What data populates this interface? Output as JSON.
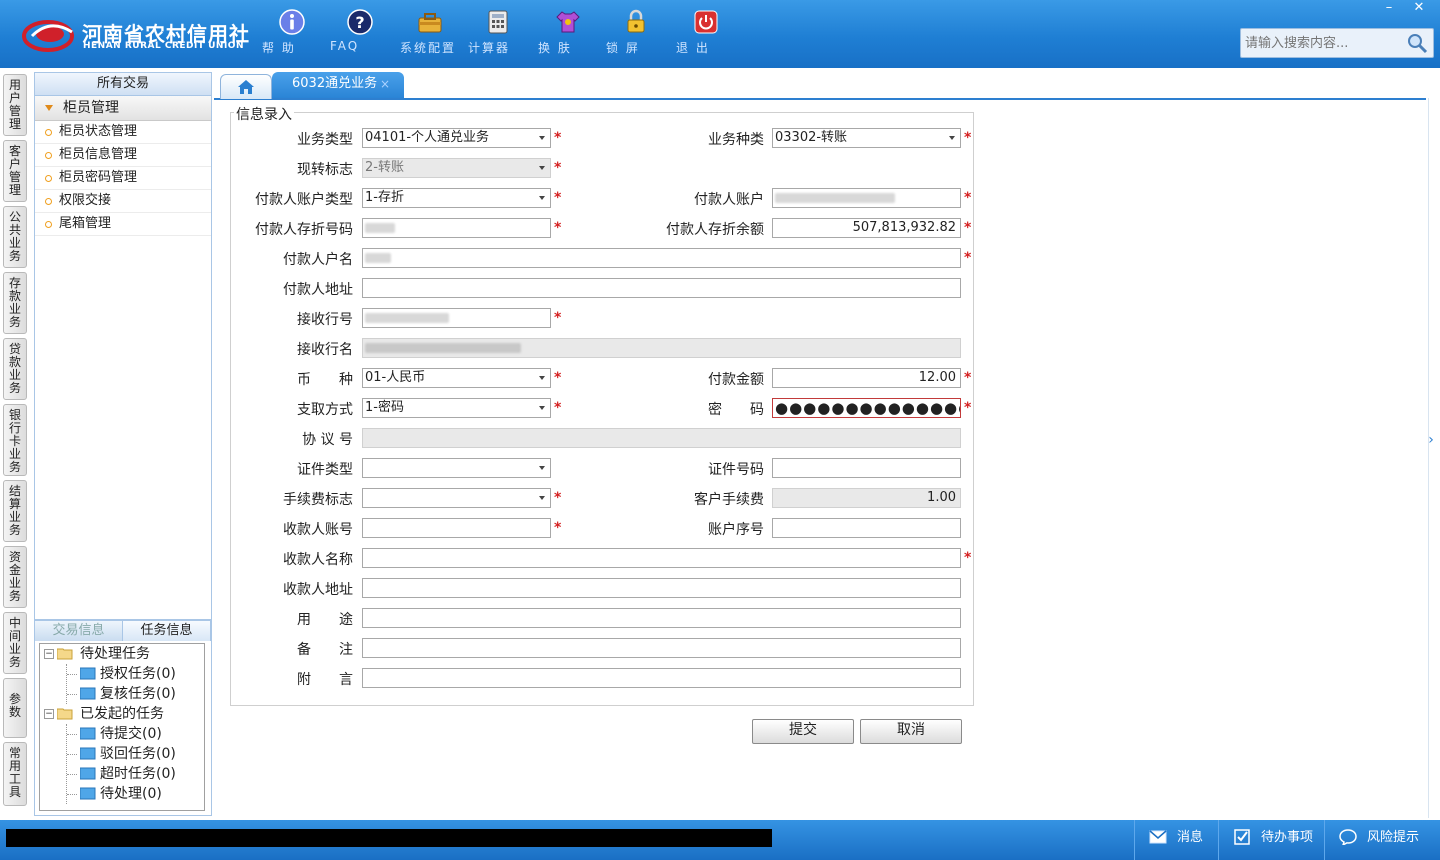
{
  "app": {
    "logo_cn": "河南省农村信用社",
    "logo_en": "HENAN RURAL CREDIT UNION",
    "toolbar": [
      {
        "label": "帮 助",
        "icon": "info-icon"
      },
      {
        "label": "FAQ",
        "icon": "question-icon"
      },
      {
        "label": "系统配置",
        "icon": "toolbox-icon"
      },
      {
        "label": "计算器",
        "icon": "calculator-icon"
      },
      {
        "label": "换 肤",
        "icon": "tshirt-icon"
      },
      {
        "label": "锁 屏",
        "icon": "lock-icon"
      },
      {
        "label": "退 出",
        "icon": "power-icon"
      }
    ],
    "window": {
      "minimize": "–",
      "close": "✕"
    },
    "search": {
      "placeholder": "请输入搜索内容..."
    }
  },
  "vtabs": [
    "用户管理",
    "客户管理",
    "公共业务",
    "存款业务",
    "贷款业务",
    "银行卡业务",
    "结算业务",
    "资金业务",
    "中间业务",
    "参数",
    "常用工具"
  ],
  "sidebar": {
    "title": "所有交易",
    "group": "柜员管理",
    "items": [
      "柜员状态管理",
      "柜员信息管理",
      "柜员密码管理",
      "权限交接",
      "尾箱管理"
    ]
  },
  "taskpanel": {
    "tabs": [
      "交易信息",
      "任务信息"
    ],
    "tree": {
      "pending": "待处理任务",
      "auth": "授权任务(0)",
      "review": "复核任务(0)",
      "initiated": "已发起的任务",
      "to_submit": "待提交(0)",
      "rejected": "驳回任务(0)",
      "timeout": "超时任务(0)",
      "to_process": "待处理(0)"
    }
  },
  "content": {
    "active_tab": "6032通兑业务",
    "tab_close": "×",
    "fieldset": "信息录入",
    "labels": {
      "biz_type": "业务类型",
      "biz_kind": "业务种类",
      "cash_flag": "现转标志",
      "payer_acct_type": "付款人账户类型",
      "payer_acct": "付款人账户",
      "passbook_no": "付款人存折号码",
      "passbook_bal": "付款人存折余额",
      "payer_name": "付款人户名",
      "payer_addr": "付款人地址",
      "recv_bank_no": "接收行号",
      "recv_bank_name": "接收行名",
      "currency": "币　　种",
      "amount": "付款金额",
      "withdraw_method": "支取方式",
      "password": "密　　码",
      "agreement_no": "协 议 号",
      "id_type": "证件类型",
      "id_no": "证件号码",
      "fee_flag": "手续费标志",
      "cust_fee": "客户手续费",
      "payee_acct": "收款人账号",
      "acct_seq": "账户序号",
      "payee_name": "收款人名称",
      "payee_addr": "收款人地址",
      "purpose": "用　　途",
      "remark": "备　　注",
      "postscript": "附　　言"
    },
    "values": {
      "biz_type": "04101-个人通兑业务",
      "biz_kind": "03302-转账",
      "cash_flag": "2-转账",
      "payer_acct_type": "1-存折",
      "passbook_bal": "507,813,932.82",
      "currency": "01-人民币",
      "amount": "12.00",
      "withdraw_method": "1-密码",
      "password": "●●●●●●●●●●●●●●●",
      "cust_fee": "1.00"
    },
    "required_mark": "*",
    "buttons": {
      "submit": "提交",
      "cancel": "取消"
    }
  },
  "statusbar": {
    "messages": "消息",
    "todo": "待办事项",
    "risk": "风险提示"
  },
  "colors": {
    "header": "#1f7fd4",
    "accent": "#2d7fd0",
    "required": "#d42020"
  }
}
